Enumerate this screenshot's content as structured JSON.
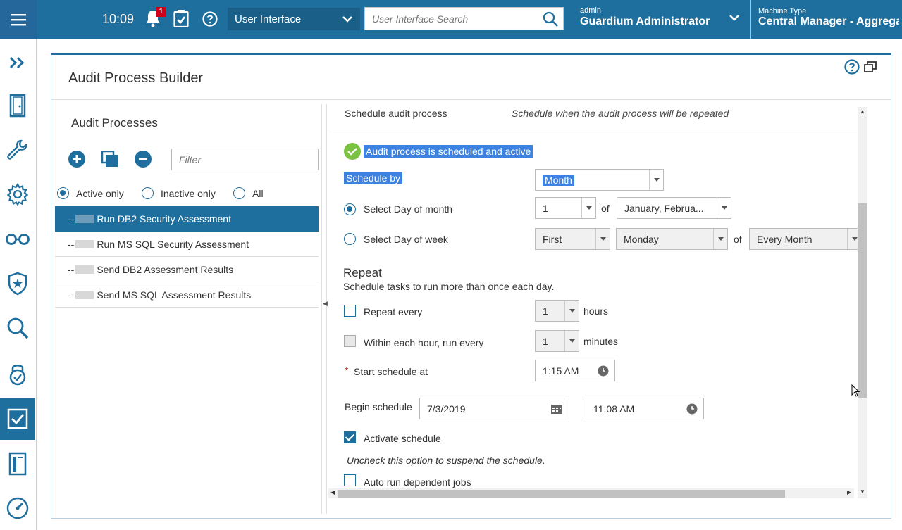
{
  "topbar": {
    "time": "10:09",
    "notification_count": "1",
    "ui_select": "User Interface",
    "search_placeholder": "User Interface Search",
    "user_role": "admin",
    "user_name": "Guardium Administrator",
    "machine_label": "Machine Type",
    "machine_value": "Central Manager - Aggregator"
  },
  "nav_icons": [
    "expand-icon",
    "door-icon",
    "wrench-icon",
    "gear-icon",
    "glasses-icon",
    "shield-icon",
    "search-icon",
    "lock-icon",
    "checklist-icon",
    "report-icon",
    "dashboard-icon"
  ],
  "panel": {
    "title": "Audit Process Builder"
  },
  "left": {
    "title": "Audit Processes",
    "filter_placeholder": "Filter",
    "radios": [
      {
        "label": "Active only",
        "checked": true
      },
      {
        "label": "Inactive only",
        "checked": false
      },
      {
        "label": "All",
        "checked": false
      }
    ],
    "processes": [
      {
        "prefix": "--",
        "name": "Run DB2 Security Assessment",
        "selected": true
      },
      {
        "prefix": "--",
        "name": "Run MS SQL Security Assessment",
        "selected": false
      },
      {
        "prefix": "--",
        "name": "Send DB2 Assessment Results",
        "selected": false
      },
      {
        "prefix": "--",
        "name": "Send MS SQL Assessment Results",
        "selected": false
      }
    ]
  },
  "schedule": {
    "header_label": "Schedule audit process",
    "header_desc": "Schedule when the audit process will be repeated",
    "status": "Audit process is scheduled and active",
    "schedule_by_label": "Schedule by",
    "schedule_by_value": "Month",
    "day_of_month_label": "Select Day of month",
    "day_of_month_value": "1",
    "of_label": "of",
    "months_value": "January, Februa...",
    "day_of_week_label": "Select Day of week",
    "week_ordinal": "First",
    "weekday": "Monday",
    "of_label_2": "of",
    "week_frequency": "Every Month",
    "repeat_title": "Repeat",
    "repeat_desc": "Schedule tasks to run more than once each day.",
    "repeat_every_label": "Repeat every",
    "repeat_every_value": "1",
    "hours_label": "hours",
    "within_hour_label": "Within each hour, run every",
    "within_hour_value": "1",
    "minutes_label": "minutes",
    "required_mark": "*",
    "start_at_label": "Start schedule at",
    "start_at_value": "1:15 AM",
    "begin_label": "Begin schedule",
    "begin_date": "7/3/2019",
    "begin_time": "11:08 AM",
    "activate_label": "Activate schedule",
    "activate_hint": "Uncheck this option to suspend the schedule.",
    "auto_run_label": "Auto run dependent jobs"
  }
}
